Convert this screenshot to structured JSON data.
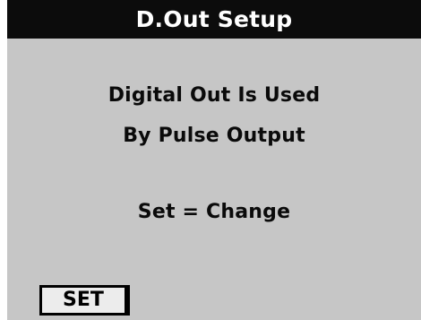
{
  "header": {
    "title": "D.Out Setup"
  },
  "message": {
    "line1": "Digital Out Is Used",
    "line2": "By Pulse Output",
    "line3": "Set = Change"
  },
  "softkeys": {
    "set_label": "SET"
  },
  "colors": {
    "title_bar_bg": "#0c0c0c",
    "title_text": "#ffffff",
    "panel_bg": "#c6c6c6",
    "text": "#0a0a0a",
    "button_bg": "#ececec"
  }
}
